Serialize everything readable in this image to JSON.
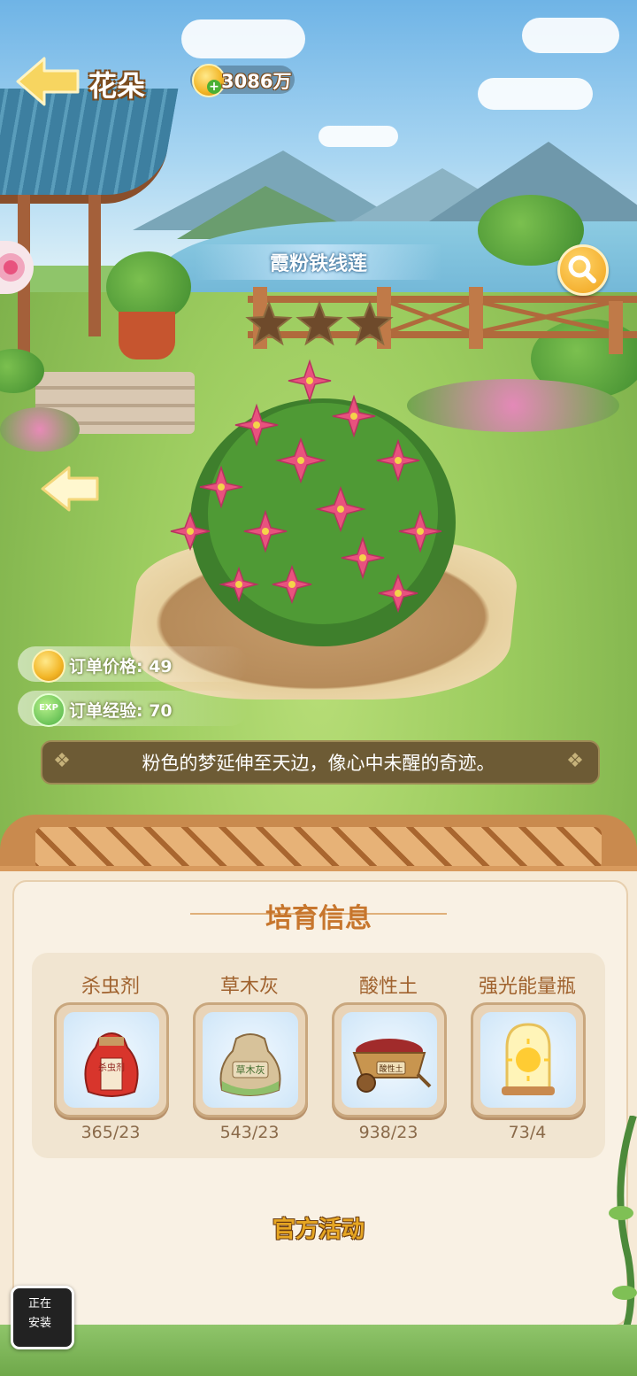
{
  "header": {
    "back_icon": "back-arrow-icon",
    "title": "花朵",
    "coins": "3086万",
    "coin_icon": "gold-coin-icon",
    "add_icon": "plus-icon"
  },
  "flower": {
    "name": "霞粉铁线莲",
    "star_count": 3,
    "stars_filled": 0,
    "color": "#e8527e"
  },
  "order": {
    "price_label": "订单价格: 49",
    "exp_label": "订单经验: 70",
    "exp_badge": "EXP"
  },
  "quote": "粉色的梦延伸至天边，像心中未醒的奇迹。",
  "cultivation": {
    "title": "培育信息",
    "items": [
      {
        "label": "杀虫剂",
        "count": "365/23",
        "icon": "pesticide-bag-icon",
        "tag": "杀虫剂"
      },
      {
        "label": "草木灰",
        "count": "543/23",
        "icon": "plant-ash-sack-icon",
        "tag": "草木灰"
      },
      {
        "label": "酸性土",
        "count": "938/23",
        "icon": "acid-soil-cart-icon",
        "tag": "酸性土"
      },
      {
        "label": "强光能量瓶",
        "count": "73/4",
        "icon": "sunlight-jar-icon",
        "tag": ""
      }
    ]
  },
  "official_activity": "官方活动",
  "installing_badge": {
    "line1": "正在",
    "line2": "安装"
  },
  "colors": {
    "accent": "#c7762d",
    "panel_bg": "#f6ead7",
    "coin": "#f2b526",
    "quote_bg": "#6d5b35"
  }
}
